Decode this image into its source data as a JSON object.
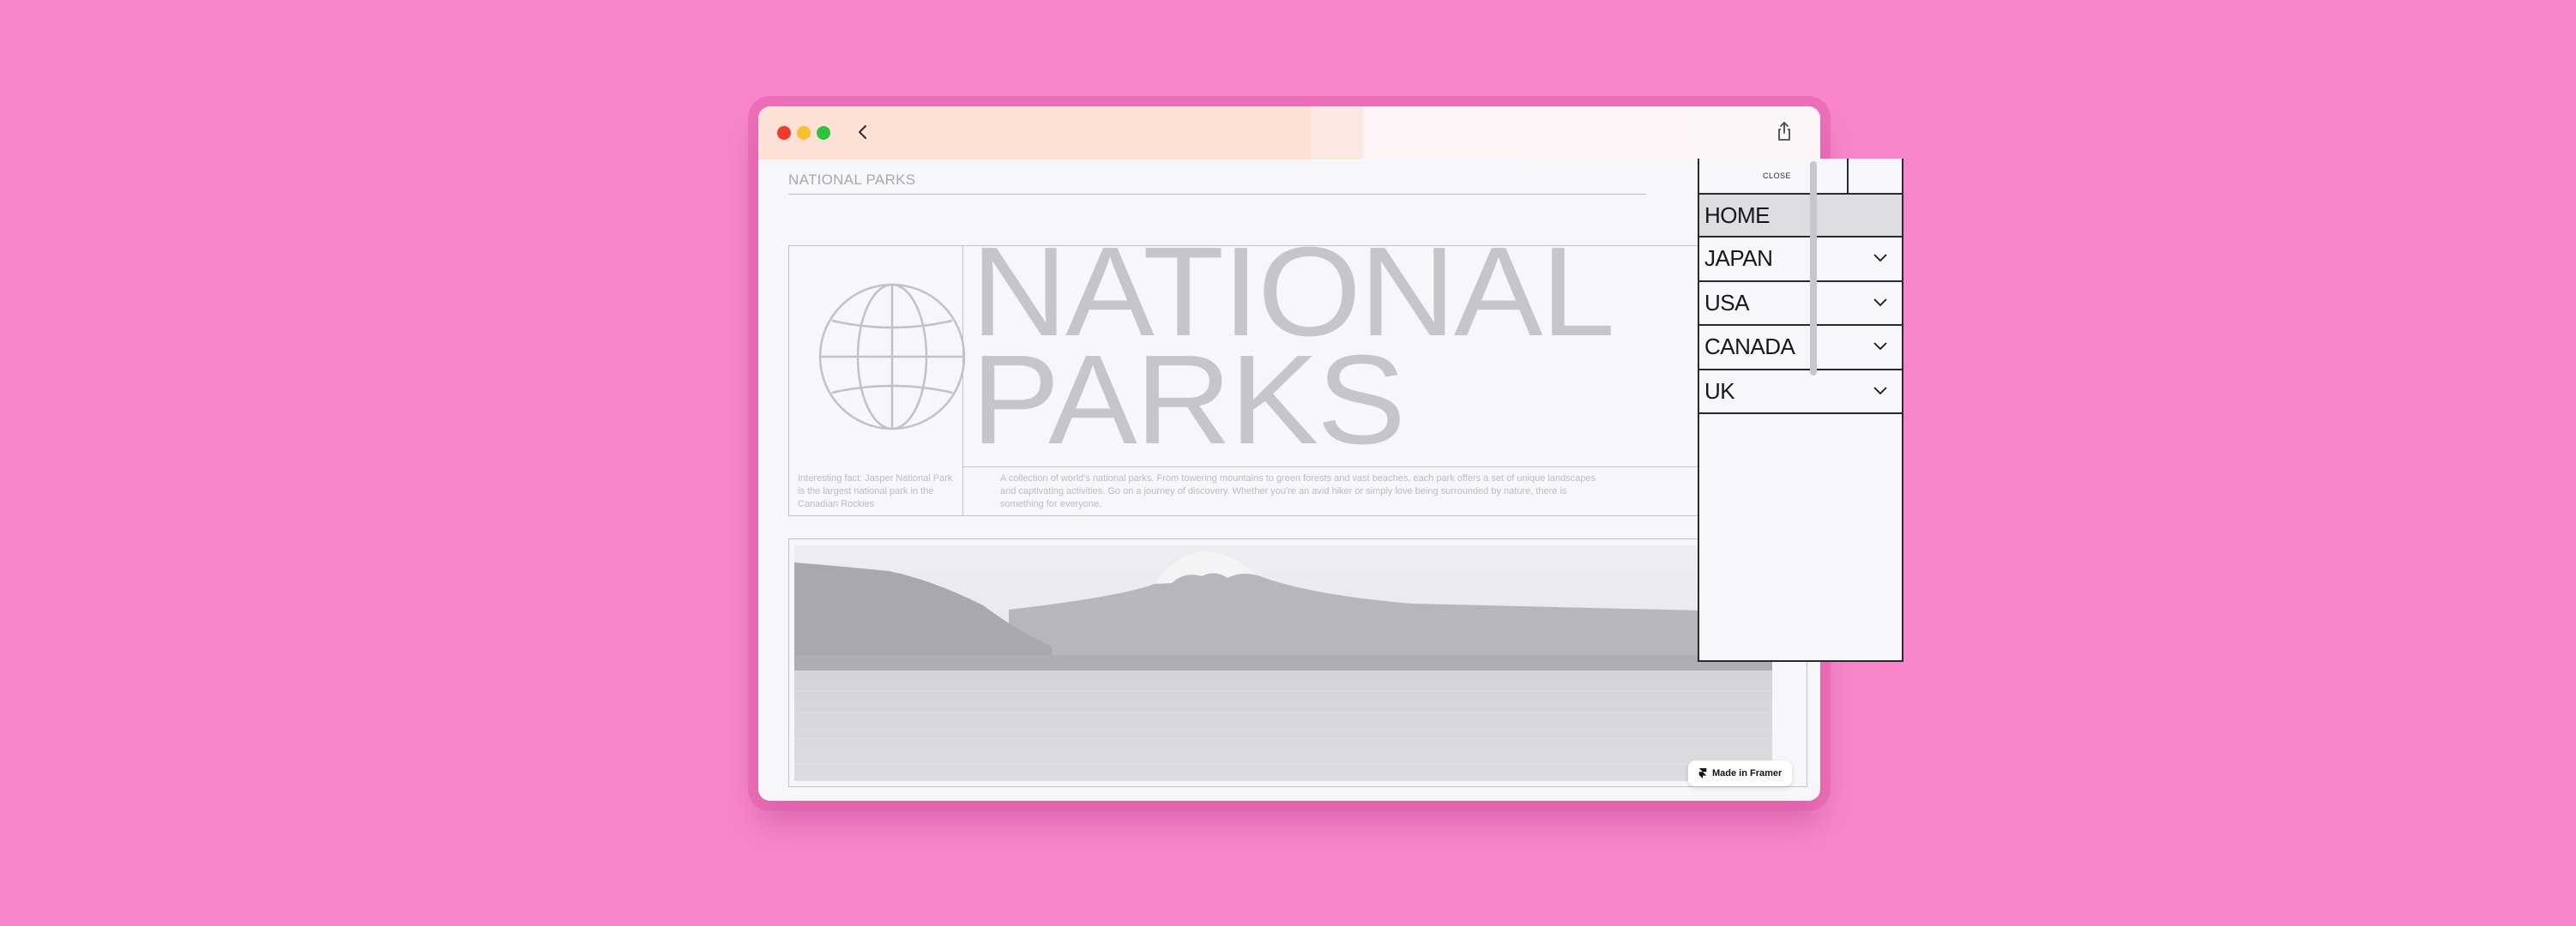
{
  "browser": {
    "back_icon": "chevron-left-icon",
    "share_icon": "share-icon"
  },
  "site": {
    "title": "NATIONAL PARKS",
    "hero_line1": "NATIONAL",
    "hero_line2": "PARKS",
    "globe_icon": "globe-icon",
    "fact_text": "Interesting fact: Jasper National Park is the largest national park in the Canadian Rockies",
    "description": "A collection of world's national parks. From towering mountains to green forests and vast beaches, each park offers a set of unique landscapes and captivating activities. Go on a journey of discovery. Whether you're an avid hiker or simply love being surrounded by nature, there is something for everyone."
  },
  "menu": {
    "close_label": "CLOSE",
    "items": [
      {
        "label": "HOME",
        "active": true
      },
      {
        "label": "JAPAN",
        "icon": "chevron-down-icon"
      },
      {
        "label": "USA",
        "icon": "chevron-down-icon"
      },
      {
        "label": "CANADA",
        "icon": "chevron-down-icon"
      },
      {
        "label": "UK",
        "icon": "chevron-down-icon"
      }
    ]
  },
  "badge": {
    "label": "Made in Framer"
  },
  "colors": {
    "background": "#f986cb",
    "hero_text": "#c6c5cb",
    "menu_border": "#2a2a2e"
  }
}
